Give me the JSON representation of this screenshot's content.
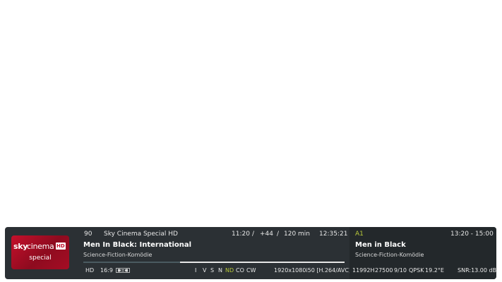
{
  "channel": {
    "number": "90",
    "name": "Sky Cinema Special HD",
    "logo": {
      "brand": "sky",
      "word": "cinema",
      "badge": "HD",
      "sub": "special"
    }
  },
  "now": {
    "start": "11:20",
    "separator1": "/",
    "elapsed": "+44",
    "separator2": "/",
    "duration": "120 min",
    "clock": "12:35:21",
    "title": "Men In Black: International",
    "genre": "Science-Fiction-Komödie",
    "progress_fraction": 0.37
  },
  "flags": {
    "hd": "HD",
    "aspect": "16:9",
    "audio_icon": "dolby-icon",
    "letters": [
      "I",
      "V",
      "S",
      "N",
      "ND",
      "CO",
      "CW"
    ],
    "active_color": "#b9c93a",
    "resolution": "1920x1080i50 [H.264/AVC]"
  },
  "next": {
    "slot": "A1",
    "time": "13:20  - 15:00",
    "title": "Men in Black",
    "genre": "Science-Fiction-Komödie"
  },
  "tuner": {
    "freq": "11992H",
    "symbolrate": "27500",
    "fec": "9/10",
    "modulation": "QPSK",
    "position": "19.2°E",
    "snr": "SNR:13.00 dB"
  }
}
